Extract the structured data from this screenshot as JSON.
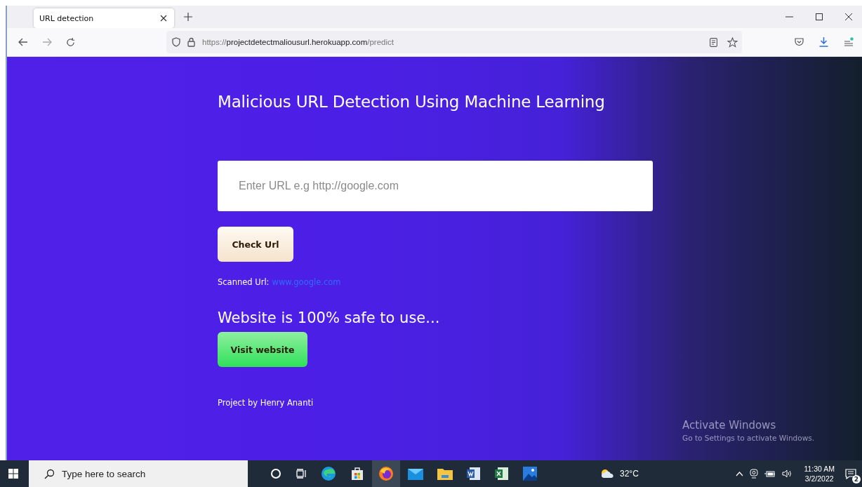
{
  "browser": {
    "tabs": [
      {
        "label": "URL detection",
        "selected": true
      }
    ],
    "address": {
      "scheme": "https://",
      "host": "projectdetectmaliousurl.herokuapp.com",
      "path": "/predict"
    }
  },
  "page": {
    "title": "Malicious URL Detection Using Machine Learning",
    "url_field": {
      "placeholder": "Enter URL e.g http://google.com"
    },
    "check_button": "Check Url",
    "scanned": {
      "label": "Scanned Url:",
      "link": "www.google.com"
    },
    "result": "Website is 100% safe to use...",
    "visit_button": "Visit website",
    "footer": "Project by Henry Ananti"
  },
  "activation": {
    "title": "Activate Windows",
    "hint": "Go to Settings to activate Windows."
  },
  "taskbar": {
    "search_placeholder": "Type here to search",
    "weather": "32°C",
    "time": "11:30 AM",
    "date": "3/2/2022",
    "notifications": "2"
  }
}
